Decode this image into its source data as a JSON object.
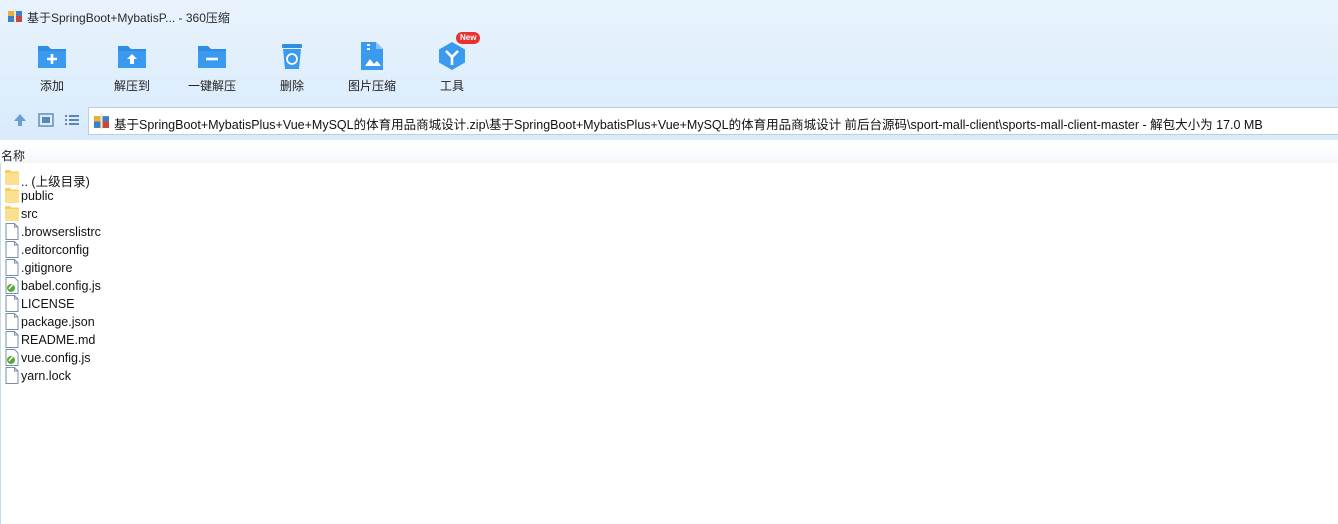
{
  "window": {
    "title": "基于SpringBoot+MybatisP... - 360压缩"
  },
  "toolbar": {
    "items": [
      {
        "label": "添加",
        "icon": "add-folder-icon"
      },
      {
        "label": "解压到",
        "icon": "extract-to-icon"
      },
      {
        "label": "一键解压",
        "icon": "one-click-extract-icon"
      },
      {
        "label": "删除",
        "icon": "trash-icon"
      },
      {
        "label": "图片压缩",
        "icon": "image-compress-icon"
      },
      {
        "label": "工具",
        "icon": "tools-icon"
      }
    ],
    "new_badge": "New"
  },
  "nav": {
    "up_icon": "up-arrow-icon",
    "view1_icon": "thumbnail-view-icon",
    "view2_icon": "list-view-icon",
    "address": "基于SpringBoot+MybatisPlus+Vue+MySQL的体育用品商城设计.zip\\基于SpringBoot+MybatisPlus+Vue+MySQL的体育用品商城设计 前后台源码\\sport-mall-client\\sports-mall-client-master - 解包大小为 17.0 MB"
  },
  "list": {
    "column_name": "名称",
    "files": [
      {
        "name": ".. (上级目录)",
        "type": "folder"
      },
      {
        "name": "public",
        "type": "folder"
      },
      {
        "name": "src",
        "type": "folder"
      },
      {
        "name": ".browserslistrc",
        "type": "file"
      },
      {
        "name": ".editorconfig",
        "type": "file"
      },
      {
        "name": ".gitignore",
        "type": "file"
      },
      {
        "name": "babel.config.js",
        "type": "js"
      },
      {
        "name": "LICENSE",
        "type": "file"
      },
      {
        "name": "package.json",
        "type": "file"
      },
      {
        "name": "README.md",
        "type": "file"
      },
      {
        "name": "vue.config.js",
        "type": "js"
      },
      {
        "name": "yarn.lock",
        "type": "file"
      }
    ]
  },
  "colors": {
    "toolbar_blue": "#2f8de4",
    "badge_red": "#e8322f",
    "folder_yellow": "#f9d776"
  }
}
